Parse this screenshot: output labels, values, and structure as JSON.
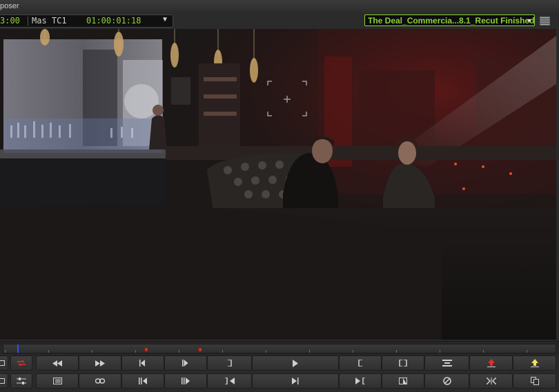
{
  "window": {
    "title": "poser"
  },
  "timecode_bar": {
    "left_timecode": "3:00",
    "track_label": "Mas TC1",
    "timecode": "01:00:01:18",
    "clip_name": "The Deal_Commercia...8.1_Recut Finished"
  },
  "icons": {
    "dropdown": "chevron-down-icon",
    "menu": "hamburger-menu-icon",
    "focus": "focus-reticle-icon"
  },
  "colors": {
    "timecode_green": "#8fd13a",
    "playhead_blue": "#2a55ff",
    "marker_red": "#c23a2a"
  },
  "transport_row1": [
    "toggle-source-icon",
    "rewind-icon",
    "fast-forward-icon",
    "step-back-icon",
    "step-forward-icon",
    "mark-out-icon",
    "play-icon",
    "mark-in-icon",
    "mark-clip-icon",
    "trim-icon",
    "lift-icon",
    "extract-icon"
  ],
  "transport_row2": [
    "toggle-view-icon",
    "settings-sliders-icon",
    "list-icon",
    "link-icon",
    "step-back-frames-icon",
    "step-forward-frames-icon",
    "go-to-out-icon",
    "go-to-end-icon",
    "go-to-in-icon",
    "sync-icon",
    "clear-icon",
    "split-icon",
    "copy-icon"
  ]
}
